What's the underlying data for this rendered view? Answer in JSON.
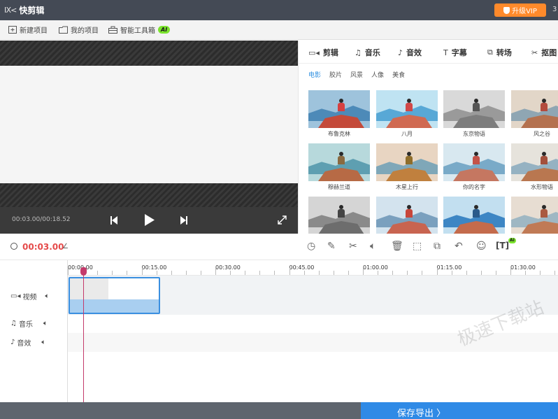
{
  "app": {
    "logo_mark": "Ⅸ<",
    "title": "快剪辑",
    "vip_label": "升级VIP",
    "titlebar_extra": "3"
  },
  "menubar": {
    "items": [
      {
        "label": "新建项目",
        "icon": "new-project-icon"
      },
      {
        "label": "我的项目",
        "icon": "folder-icon"
      },
      {
        "label": "智能工具箱",
        "icon": "toolbox-icon"
      }
    ],
    "ai_badge": "AI"
  },
  "player": {
    "timecode": "00:03.00/00:18.52"
  },
  "panel": {
    "tabs": [
      {
        "label": "剪辑",
        "icon": "▭◂"
      },
      {
        "label": "音乐",
        "icon": "♫"
      },
      {
        "label": "音效",
        "icon": "♪"
      },
      {
        "label": "字幕",
        "icon": "T"
      },
      {
        "label": "转场",
        "icon": "⧉"
      },
      {
        "label": "抠图",
        "icon": "✂"
      }
    ],
    "subtabs": [
      "电影",
      "胶片",
      "风景",
      "人像",
      "美食"
    ],
    "active_subtab": "电影",
    "filters": [
      {
        "label": "布鲁克林",
        "sky": "#9ec3dc",
        "mtn": "#4d8ab8",
        "rock": "#c44a3a",
        "shirt": "#d64040"
      },
      {
        "label": "八月",
        "sky": "#bfe3f2",
        "mtn": "#58a8d6",
        "rock": "#d06a52",
        "shirt": "#d14848"
      },
      {
        "label": "东京物语",
        "sky": "#d9d9d9",
        "mtn": "#9a9a9a",
        "rock": "#7d7d7d",
        "shirt": "#555555"
      },
      {
        "label": "风之谷",
        "sky": "#e2d6c8",
        "mtn": "#8fa6b3",
        "rock": "#b4714f",
        "shirt": "#b34c3e"
      },
      {
        "label": "穆赫兰道",
        "sky": "#b7d9dc",
        "mtn": "#5e9fb1",
        "rock": "#b76a45",
        "shirt": "#8a6a40"
      },
      {
        "label": "木星上行",
        "sky": "#e8d5c2",
        "mtn": "#7fa7b8",
        "rock": "#c0803e",
        "shirt": "#8f6d2a"
      },
      {
        "label": "你的名字",
        "sky": "#d8e8f0",
        "mtn": "#79aac8",
        "rock": "#c57761",
        "shirt": "#c45349"
      },
      {
        "label": "水形物语",
        "sky": "#e6e3dc",
        "mtn": "#95b2c2",
        "rock": "#b97750",
        "shirt": "#a3503c"
      },
      {
        "label": "",
        "sky": "#d5d5d5",
        "mtn": "#8a8a8a",
        "rock": "#6d6d6d",
        "shirt": "#444444"
      },
      {
        "label": "",
        "sky": "#d3e3ee",
        "mtn": "#7aa0be",
        "rock": "#c86450",
        "shirt": "#c8463a"
      },
      {
        "label": "",
        "sky": "#c2dff0",
        "mtn": "#3d86c4",
        "rock": "#c46b4c",
        "shirt": "#2a5a8a"
      },
      {
        "label": "",
        "sky": "#e7ddd2",
        "mtn": "#9fb7c3",
        "rock": "#c07a55",
        "shirt": "#aa5a40"
      }
    ]
  },
  "timeline": {
    "current_time": "00:03.00",
    "ruler_labels": [
      "00:00.00",
      "00:15.00",
      "00:30.00",
      "00:45.00",
      "01:00.00",
      "01:15.00",
      "01:30.00"
    ],
    "tracks": [
      {
        "label": "视频",
        "icon": "video-track-icon"
      },
      {
        "label": "音乐",
        "icon": "music-track-icon"
      },
      {
        "label": "音效",
        "icon": "sfx-track-icon"
      }
    ],
    "ai_mini": "AI"
  },
  "watermark": "极速下载站",
  "export_label": "保存导出 〉"
}
